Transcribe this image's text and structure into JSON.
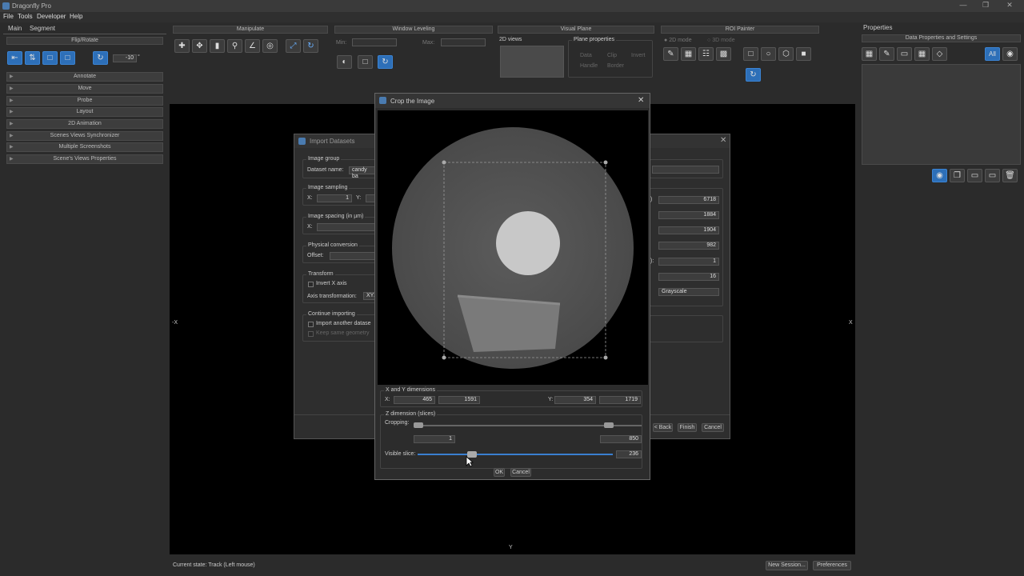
{
  "app": {
    "title": "Dragonfly Pro"
  },
  "menu": [
    "File",
    "Tools",
    "Developer",
    "Help"
  ],
  "tabs": [
    "Main",
    "Segment"
  ],
  "left_panel": {
    "header": "Flip/Rotate",
    "rotation_value": "-10",
    "rotation_unit": "°",
    "sections": [
      "Annotate",
      "Move",
      "Probe",
      "Layout",
      "2D Animation",
      "Scenes Views Synchronizer",
      "Multiple Screenshots",
      "Scene's Views Properties"
    ]
  },
  "toolbar": {
    "manipulate": "Manipulate",
    "window_leveling": "Window Leveling",
    "min_label": "Min:",
    "max_label": "Max:",
    "visual_plane": "Visual Plane",
    "views_2d": "2D views",
    "plane_properties": "Plane properties",
    "plane_opts": [
      "Data",
      "Clip",
      "Invert",
      "Handle",
      "Border"
    ],
    "roi_painter": "ROI Painter",
    "mode_2d": "2D mode",
    "mode_3d": "3D mode"
  },
  "properties": {
    "title": "Properties",
    "header": "Data Properties and Settings",
    "all_label": "All"
  },
  "viewport": {
    "left_axis": "-X",
    "right_axis": "X",
    "bottom_axis": "Y"
  },
  "import_dialog": {
    "title": "Import Datasets",
    "image_group": "Image group",
    "dataset_name_label": "Dataset name:",
    "dataset_name_value": "candy ba",
    "image_sampling": "Image sampling",
    "x_label": "X:",
    "x_value": "1",
    "y_label": "Y:",
    "image_spacing": "Image spacing (in µm)",
    "spacing_x_label": "X:",
    "physical_conversion": "Physical conversion",
    "offset_label": "Offset:",
    "transform": "Transform",
    "invert_x": "Invert X axis",
    "axis_transformation": "Axis transformation:",
    "axis_value": "XYZ",
    "continue_importing": "Continue importing",
    "import_another": "Import another datase",
    "keep_geometry": "Keep same geometry",
    "right_values": [
      "6718",
      "1884",
      "1904",
      "982",
      "1",
      "16"
    ],
    "right_prefix": [
      ")",
      "",
      "",
      "",
      "):",
      ""
    ],
    "grayscale": "Grayscale",
    "back": "< Back",
    "finish": "Finish",
    "cancel": "Cancel"
  },
  "crop_dialog": {
    "title": "Crop the Image",
    "xy_group": "X and Y dimensions",
    "x_label": "X:",
    "x_min": "465",
    "x_max": "1591",
    "y_label": "Y:",
    "y_min": "354",
    "y_max": "1719",
    "z_group": "Z dimension (slices)",
    "cropping_label": "Cropping:",
    "z_min": "1",
    "z_max": "850",
    "visible_slice_label": "Visible slice:",
    "visible_slice": "236",
    "visible_slice_fraction": 0.28,
    "ok": "OK",
    "cancel": "Cancel"
  },
  "status": {
    "state": "Current state: Track (Left mouse)",
    "new_session": "New Session...",
    "preferences": "Preferences"
  }
}
